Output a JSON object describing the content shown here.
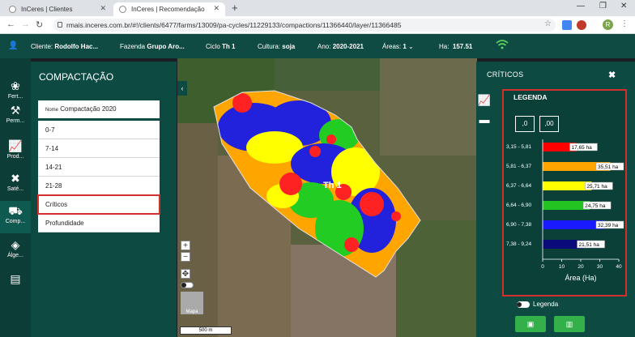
{
  "browser": {
    "tabs": [
      {
        "label": "InCeres | Clientes"
      },
      {
        "label": "InCeres | Recomendação"
      }
    ],
    "url": "rmais.inceres.com.br/#!/clients/6477/farms/13009/pa-cycles/11229133/compactions/11366440/layer/11366485",
    "profile_initial": "R"
  },
  "header": {
    "client_label": "Cliente:",
    "client_value": "Rodolfo Hac...",
    "farm_label": "Fazenda",
    "farm_value": "Grupo Aro...",
    "cycle_label": "Ciclo",
    "cycle_value": "Th 1",
    "crop_label": "Cultura:",
    "crop_value": "soja",
    "year_label": "Ano:",
    "year_value": "2020-2021",
    "areas_label": "Áreas:",
    "areas_value": "1",
    "ha_label": "Ha:",
    "ha_value": "157.51"
  },
  "nav_rail": [
    {
      "label": "Fert...",
      "icon": "fertility-icon"
    },
    {
      "label": "Perm...",
      "icon": "permission-icon"
    },
    {
      "label": "Prod...",
      "icon": "production-icon"
    },
    {
      "label": "Saté...",
      "icon": "satellite-icon"
    },
    {
      "label": "Comp...",
      "icon": "compaction-icon"
    },
    {
      "label": "Álge...",
      "icon": "layers-icon"
    },
    {
      "label": "",
      "icon": "report-icon"
    }
  ],
  "left_panel": {
    "title": "COMPACTAÇÃO",
    "name_label": "Nome",
    "name_value": "Compactação 2020",
    "items": [
      {
        "label": "0-7"
      },
      {
        "label": "7-14"
      },
      {
        "label": "14-21"
      },
      {
        "label": "21-28"
      },
      {
        "label": "Críticos"
      },
      {
        "label": "Profundidade"
      }
    ]
  },
  "map": {
    "field_label": "Th 1",
    "scale_label": "500 m",
    "map_type_label": "Mapa"
  },
  "right_panel": {
    "title": "CRÍTICOS",
    "legend_title": "LEGENDA",
    "decimal_less": ",0",
    "decimal_more": ",00",
    "toggle_label": "Legenda"
  },
  "chart_data": {
    "type": "bar",
    "orientation": "horizontal",
    "categories": [
      "3,15 - 5,81",
      "5,81 - 6,37",
      "6,37 - 6,64",
      "6,64 - 6,90",
      "6,90 - 7,38",
      "7,38 - 9,24"
    ],
    "values": [
      17.65,
      35.51,
      25.71,
      24.75,
      32.39,
      21.51
    ],
    "data_labels": [
      "17,65 ha",
      "35,51 ha",
      "25,71 ha",
      "24,75 ha",
      "32,39 ha",
      "21,51 ha"
    ],
    "colors": [
      "#ff0000",
      "#ffa500",
      "#ffff00",
      "#22c422",
      "#1a1aff",
      "#0a0a7a"
    ],
    "xlabel": "Área (Ha)",
    "xlim": [
      0,
      40
    ],
    "xticks": [
      "0",
      "10",
      "20",
      "30",
      "40"
    ],
    "grid": false
  }
}
